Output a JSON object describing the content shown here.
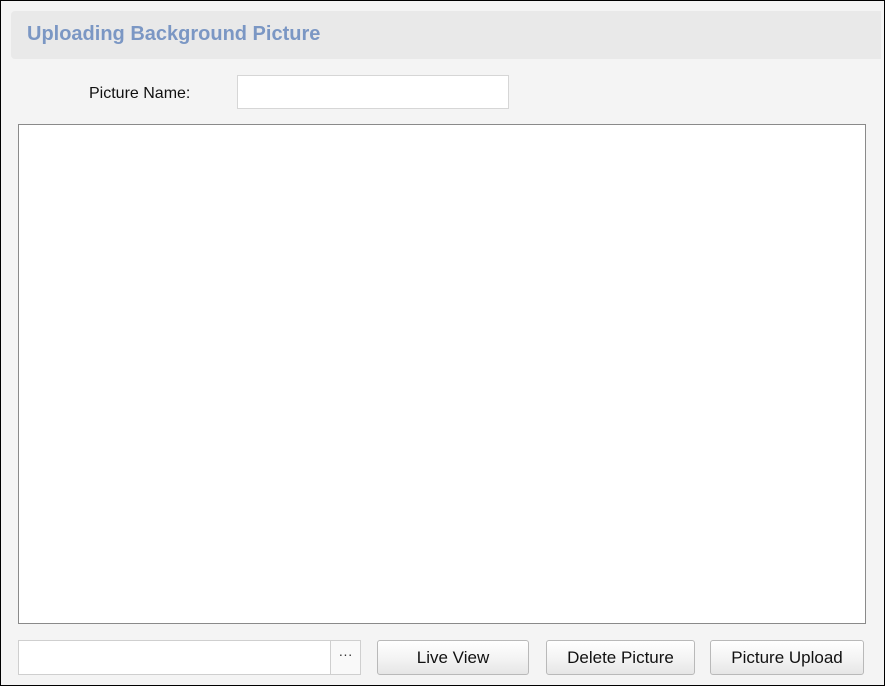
{
  "header": {
    "title": "Uploading Background Picture"
  },
  "form": {
    "picture_name_label": "Picture Name:",
    "picture_name_value": "",
    "file_path_value": "",
    "browse_label": "···"
  },
  "buttons": {
    "live_view": "Live View",
    "delete_picture": "Delete Picture",
    "picture_upload": "Picture Upload"
  },
  "colors": {
    "title": "#7b97c4",
    "header_bg": "#e9e9e9",
    "panel_bg": "#f4f4f4"
  }
}
